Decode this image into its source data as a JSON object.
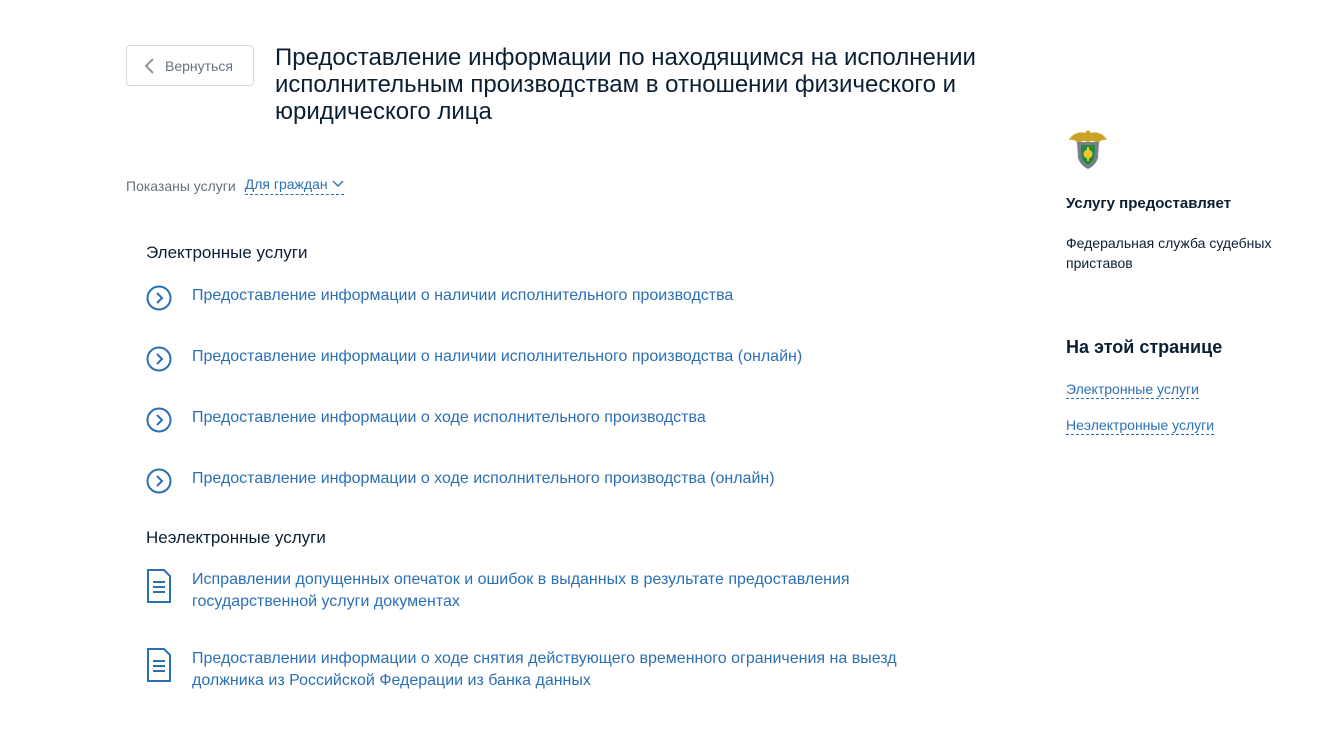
{
  "back_button": {
    "label": "Вернуться"
  },
  "page_title": "Предоставление информации по находящимся на исполнении исполнительным производствам в отношении физического и юридического лица",
  "filter": {
    "lead": "Показаны услуги",
    "selected": "Для граждан"
  },
  "electronic": {
    "heading": "Электронные услуги",
    "items": [
      "Предоставление информации о наличии исполнительного производства",
      "Предоставление информации о наличии исполнительного производства (онлайн)",
      "Предоставление информации о ходе исполнительного производства",
      "Предоставление информации о ходе исполнительного производства (онлайн)"
    ]
  },
  "non_electronic": {
    "heading": "Неэлектронные услуги",
    "items": [
      "Исправлении допущенных опечаток и ошибок в выданных в результате предоставления государственной услуги документах",
      "Предоставлении информации о ходе снятия действующего временного ограничения на выезд должника из Российской Федерации из банка данных"
    ]
  },
  "sidebar": {
    "provider_heading": "Услугу предоставляет",
    "provider_name": "Федеральная служба судебных приставов",
    "on_page_heading": "На этой странице",
    "anchors": [
      "Электронные услуги",
      "Неэлектронные услуги"
    ]
  },
  "icons": {
    "back": "chevron-left-icon",
    "filter": "chevron-down-icon",
    "electronic_item": "circle-arrow-right-icon",
    "non_electronic_item": "document-icon",
    "provider": "fssp-emblem-icon"
  },
  "colors": {
    "link": "#2b6fb5",
    "text": "#0b1f33",
    "muted": "#66727f",
    "border": "#d3d8de"
  }
}
